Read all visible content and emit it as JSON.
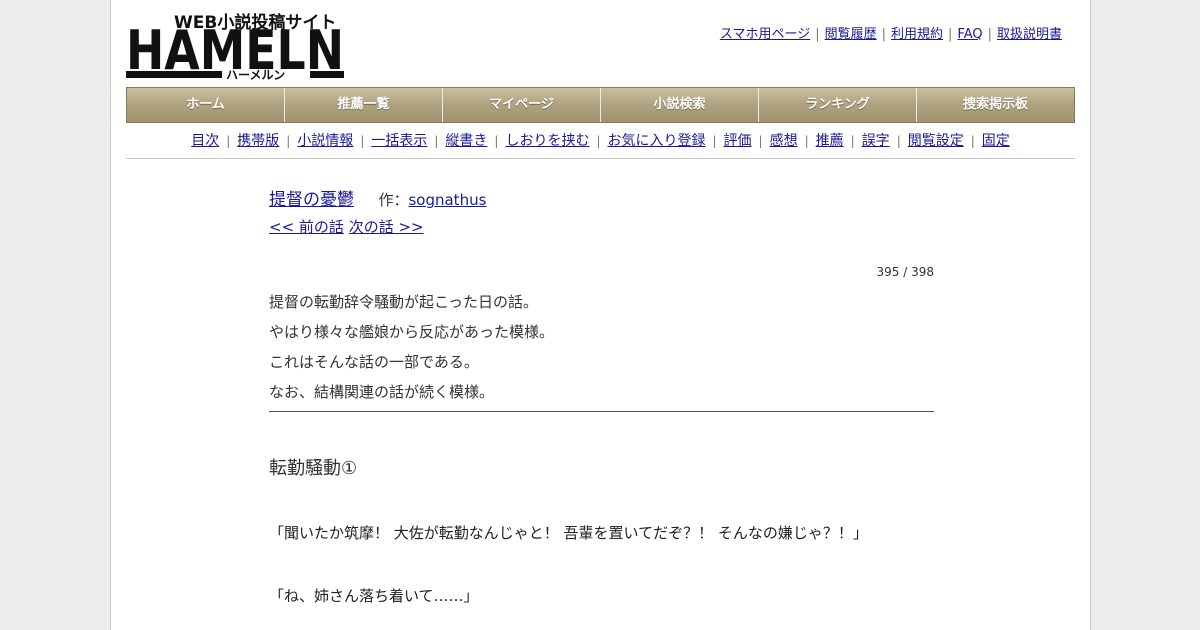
{
  "logo": {
    "tagline": "WEB小説投稿サイト",
    "wordmark": "HAMELN",
    "kana": "ハーメルン"
  },
  "top_links": [
    "スマホ用ページ",
    "閲覧履歴",
    "利用規約",
    "FAQ",
    "取扱説明書"
  ],
  "main_nav": [
    "ホーム",
    "推薦一覧",
    "マイページ",
    "小説検索",
    "ランキング",
    "捜索掲示板"
  ],
  "sub_nav": [
    "目次",
    "携帯版",
    "小説情報",
    "一括表示",
    "縦書き",
    "しおりを挟む",
    "お気に入り登録",
    "評価",
    "感想",
    "推薦",
    "誤字",
    "閲覧設定",
    "固定"
  ],
  "novel": {
    "title": "提督の憂鬱",
    "author_label": "作：",
    "author": "sognathus"
  },
  "chapter_nav": {
    "prev": "<< 前の話",
    "next": "次の話 >>"
  },
  "page_count": "395 / 398",
  "preface": [
    "提督の転勤辞令騒動が起こった日の話。",
    "やはり様々な艦娘から反応があった模様。",
    "これはそんな話の一部である。",
    "なお、結構関連の話が続く模様。"
  ],
  "chapter_title": "転勤騒動①",
  "body": [
    "「聞いたか筑摩！ 大佐が転勤なんじゃと！ 吾輩を置いてだぞ？！ そんなの嫌じゃ？！」",
    "「ね、姉さん落ち着いて……」"
  ],
  "colors": {
    "link": "#1a1a99",
    "nav_bar": "#aea27f",
    "page_bg": "#ececec"
  }
}
